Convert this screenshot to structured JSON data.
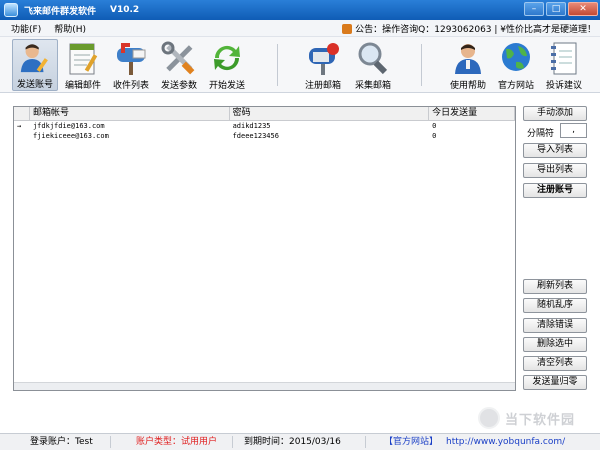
{
  "window": {
    "title": "飞来邮件群发软件",
    "version": "V10.2"
  },
  "menu": {
    "items": [
      "功能(F)",
      "帮助(H)"
    ]
  },
  "notice": {
    "text": "公告：操作咨询Q：1293062063 | ¥性价比高才是硬道理！"
  },
  "toolbar": {
    "buttons": [
      {
        "label": "发送账号",
        "icon": "user-edit-icon"
      },
      {
        "label": "编辑邮件",
        "icon": "edit-document-icon"
      },
      {
        "label": "收件列表",
        "icon": "mailbox-icon"
      },
      {
        "label": "发送参数",
        "icon": "tools-icon"
      },
      {
        "label": "开始发送",
        "icon": "refresh-icon"
      },
      {
        "label": "注册邮箱",
        "icon": "register-mailbox-icon"
      },
      {
        "label": "采集邮箱",
        "icon": "magnifier-icon"
      },
      {
        "label": "使用帮助",
        "icon": "help-person-icon"
      },
      {
        "label": "官方网站",
        "icon": "globe-icon"
      },
      {
        "label": "投诉建议",
        "icon": "notebook-icon"
      }
    ]
  },
  "table": {
    "columns": [
      "",
      "邮箱帐号",
      "密码",
      "今日发送量"
    ],
    "rows": [
      {
        "marker": "→",
        "account": "jfdkjfdie@163.com",
        "password": "adikd1235",
        "sent": "0"
      },
      {
        "marker": "",
        "account": "fjiekiceee@163.com",
        "password": "fdeee123456",
        "sent": "0"
      }
    ]
  },
  "side": {
    "manual_add": "手动添加",
    "separator_label": "分隔符",
    "separator_value": ",",
    "import": "导入列表",
    "export": "导出列表",
    "register": "注册账号",
    "refresh": "刷新列表",
    "shuffle": "随机乱序",
    "clear_errors": "清除错误",
    "delete_selected": "删除选中",
    "clear_list": "清空列表",
    "reset_count": "发送量归零"
  },
  "status": {
    "login": "登录账户：Test",
    "account_type": "账户类型：试用用户",
    "expiry": "到期时间：2015/03/16",
    "site_label": "【官方网站】",
    "site_url": "http://www.yobqunfa.com/"
  },
  "watermark": {
    "text": "当下软件园"
  },
  "colors": {
    "titlebar": "#1a6cc8",
    "status_red": "#e02020",
    "status_blue": "#1a3fc6"
  }
}
